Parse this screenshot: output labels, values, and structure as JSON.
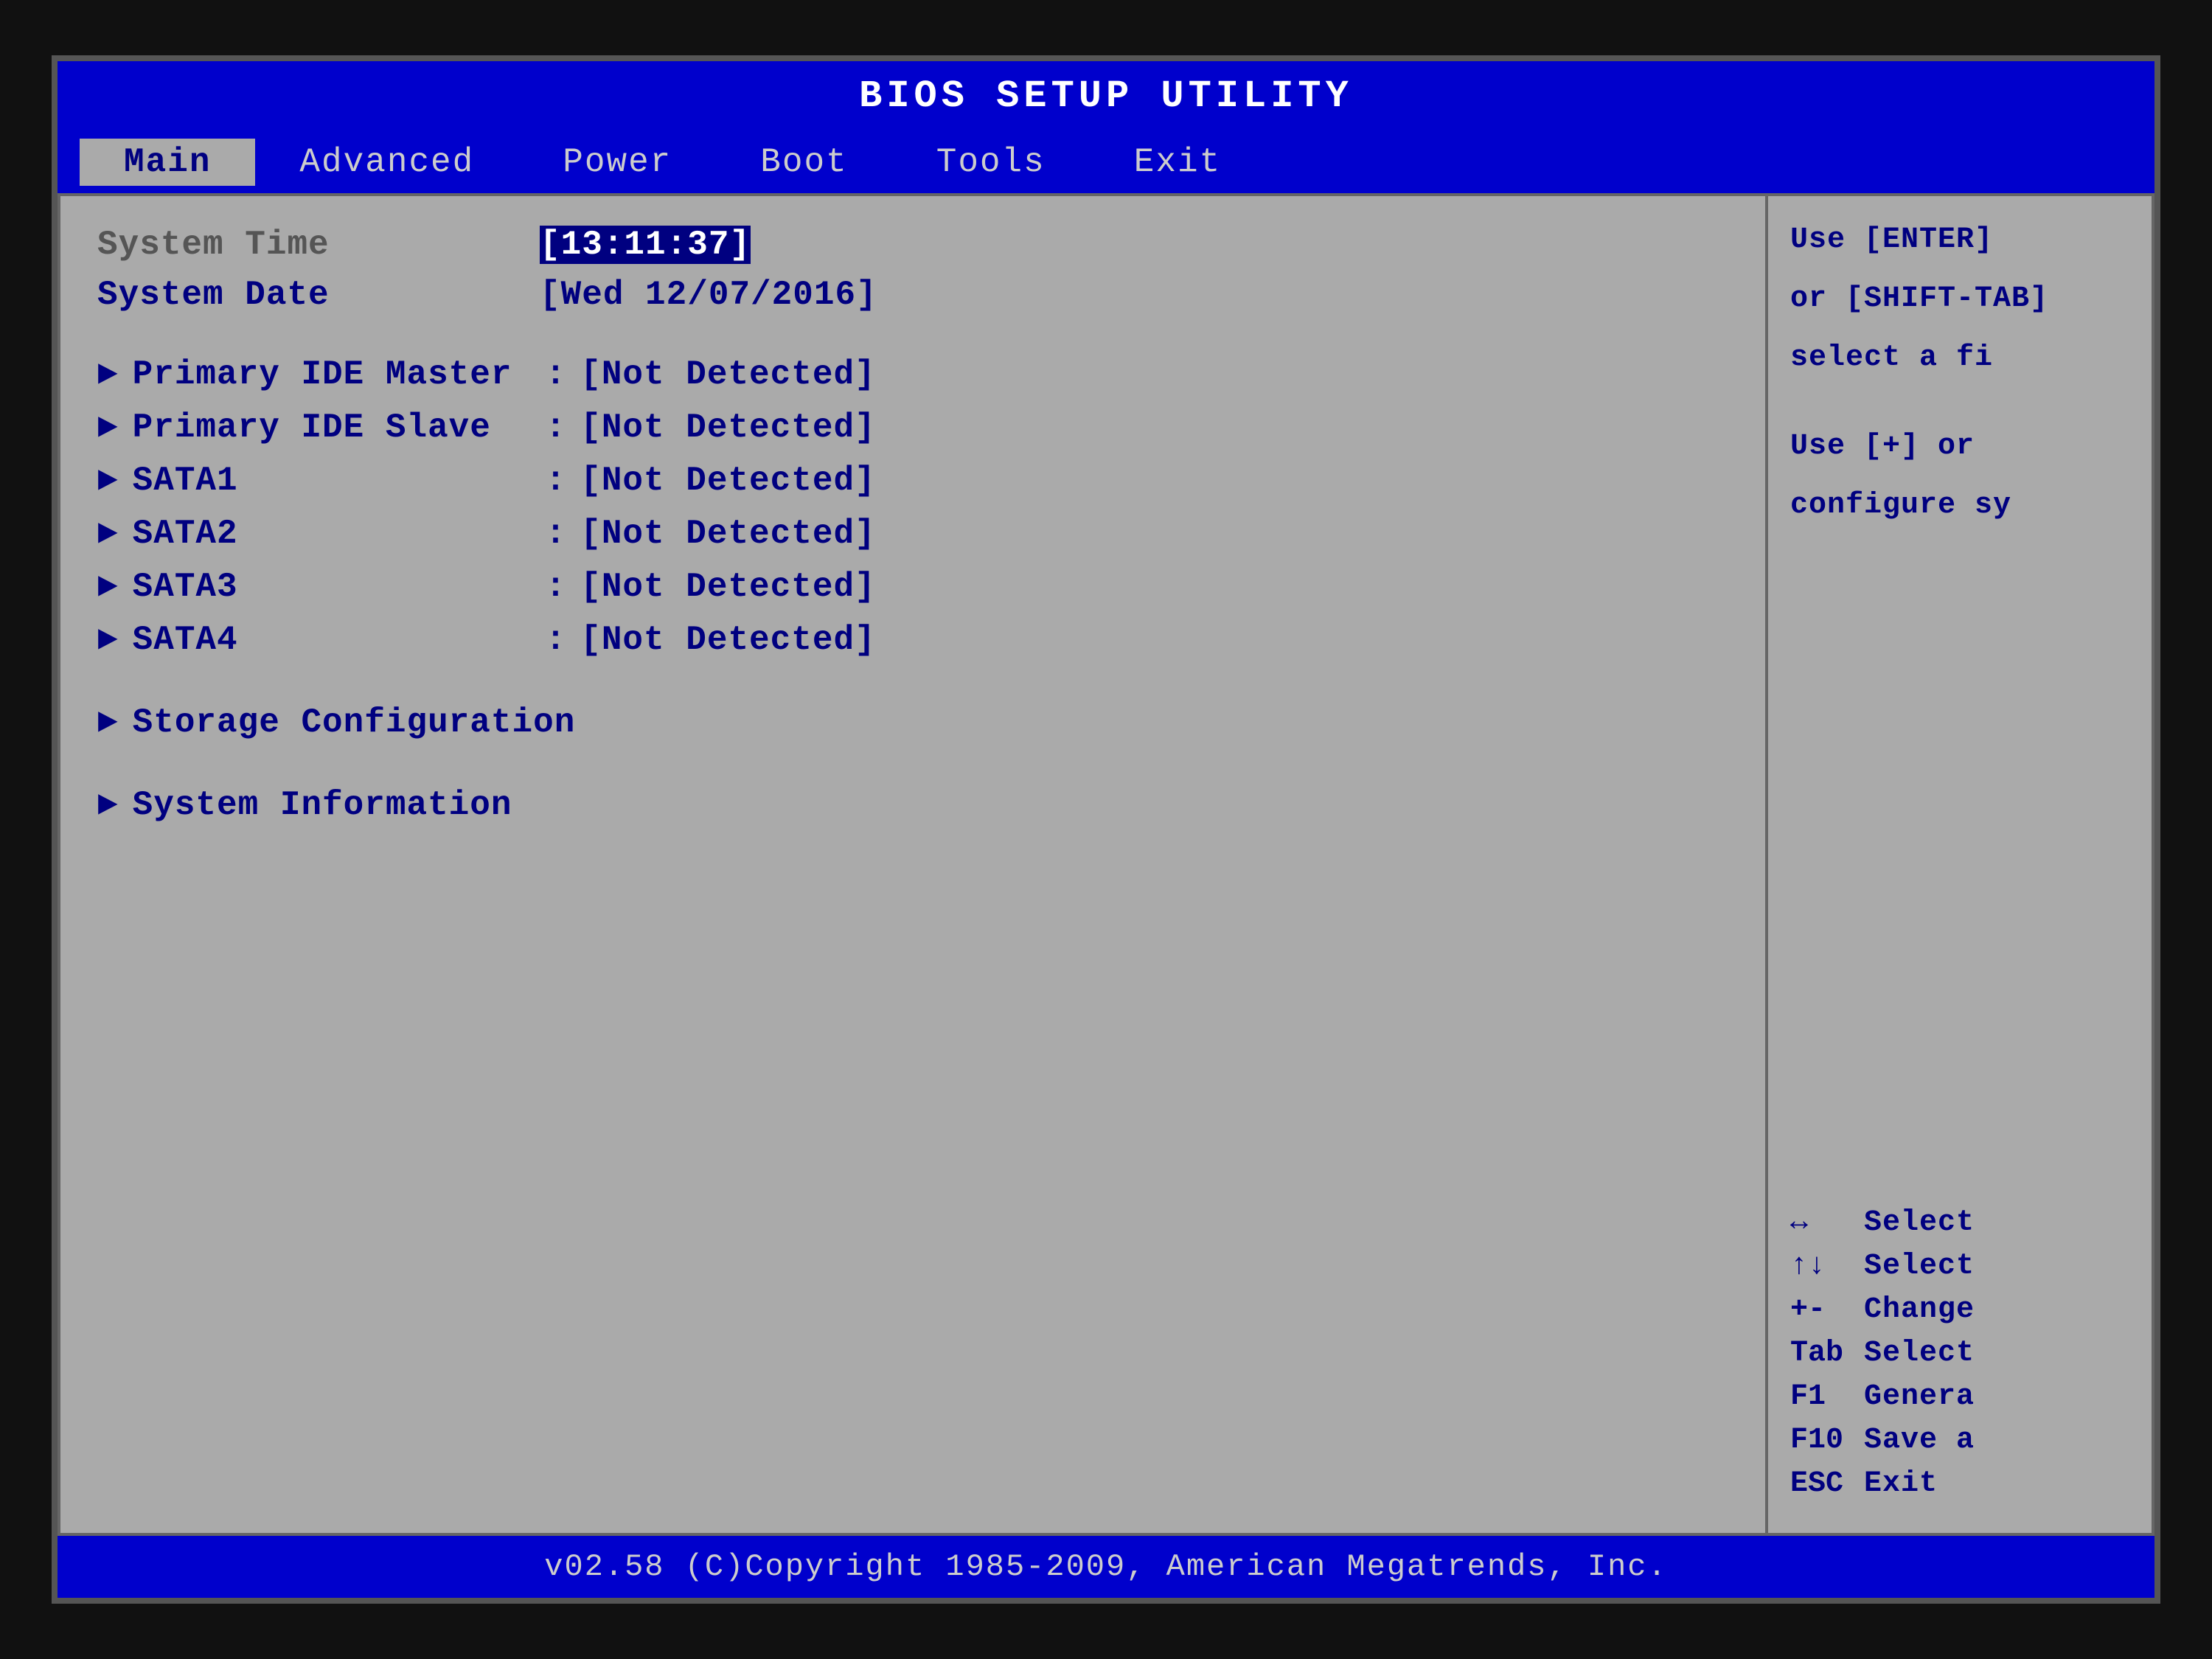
{
  "title": "BIOS  SETUP  UTILITY",
  "menu": {
    "items": [
      {
        "label": "Main",
        "active": true
      },
      {
        "label": "Advanced",
        "active": false
      },
      {
        "label": "Power",
        "active": false
      },
      {
        "label": "Boot",
        "active": false
      },
      {
        "label": "Tools",
        "active": false
      },
      {
        "label": "Exit",
        "active": false
      }
    ]
  },
  "main": {
    "system_time_label": "System Time",
    "system_time_value": "[13:11:37]",
    "system_date_label": "System Date",
    "system_date_value": "[Wed 12/07/2016]",
    "devices": [
      {
        "label": "Primary IDE Master",
        "value": "[Not Detected]"
      },
      {
        "label": "Primary IDE Slave",
        "value": "[Not Detected]"
      },
      {
        "label": "SATA1",
        "value": "[Not Detected]"
      },
      {
        "label": "SATA2",
        "value": "[Not Detected]"
      },
      {
        "label": "SATA3",
        "value": "[Not Detected]"
      },
      {
        "label": "SATA4",
        "value": "[Not Detected]"
      }
    ],
    "submenus": [
      {
        "label": "Storage Configuration"
      },
      {
        "label": "System Information"
      }
    ]
  },
  "help": {
    "line1": "Use [ENTER]",
    "line2": "or [SHIFT-TAB]",
    "line3": "select a fi",
    "line4": "Use [+] or",
    "line5": "configure sy"
  },
  "keys": [
    {
      "symbol": "↔",
      "desc": "Select"
    },
    {
      "symbol": "↑↓",
      "desc": "Select"
    },
    {
      "symbol": "+-",
      "desc": "Change"
    },
    {
      "symbol": "Tab",
      "desc": "Select"
    },
    {
      "symbol": "F1",
      "desc": "Genera"
    },
    {
      "symbol": "F10",
      "desc": "Save a"
    },
    {
      "symbol": "ESC",
      "desc": "Exit"
    }
  ],
  "footer": "v02.58  (C)Copyright 1985-2009, American Megatrends, Inc."
}
